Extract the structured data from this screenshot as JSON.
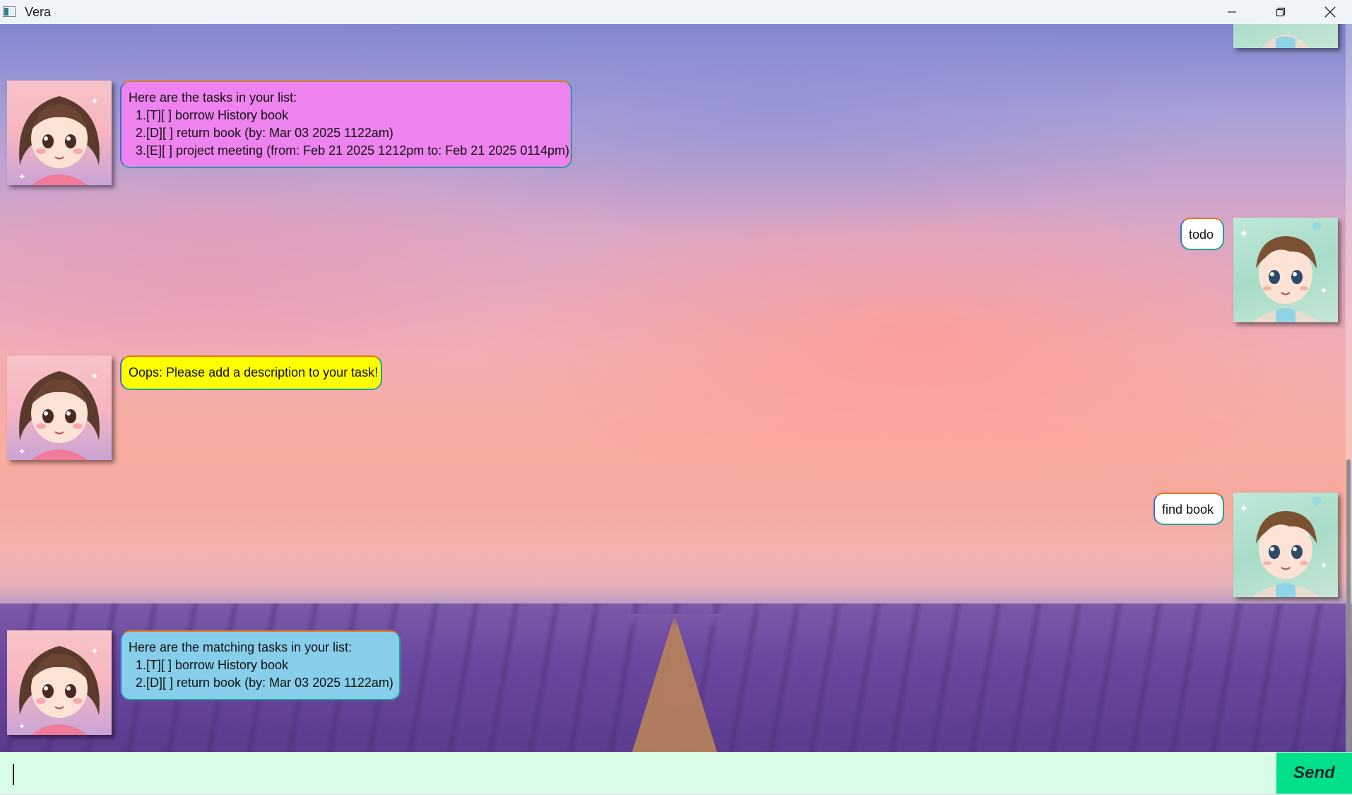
{
  "window": {
    "title": "Vera"
  },
  "messages": [
    {
      "sender": "vera",
      "style": "pink",
      "lines": [
        "Here are the tasks in your list:",
        "  1.[T][ ] borrow History book",
        "  2.[D][ ] return book (by: Mar 03 2025 1122am)",
        "  3.[E][ ] project meeting (from: Feb 21 2025 1212pm to: Feb 21 2025 0114pm)"
      ]
    },
    {
      "sender": "user",
      "lines": [
        "todo"
      ]
    },
    {
      "sender": "vera",
      "style": "yellow",
      "lines": [
        "Oops: Please add a description to your task!"
      ]
    },
    {
      "sender": "user",
      "lines": [
        "find book"
      ]
    },
    {
      "sender": "vera",
      "style": "blue",
      "lines": [
        "Here are the matching tasks in your list:",
        "  1.[T][ ] borrow History book",
        "  2.[D][ ] return book (by: Mar 03 2025 1122am)"
      ]
    }
  ],
  "input": {
    "value": "",
    "placeholder": ""
  },
  "send": {
    "label": "Send"
  },
  "colors": {
    "bubble_pink": "#ee82ee",
    "bubble_yellow": "#ffff00",
    "bubble_blue": "#87ceeb",
    "input_bg": "#d7fde7",
    "send_bg": "#00e08a"
  }
}
